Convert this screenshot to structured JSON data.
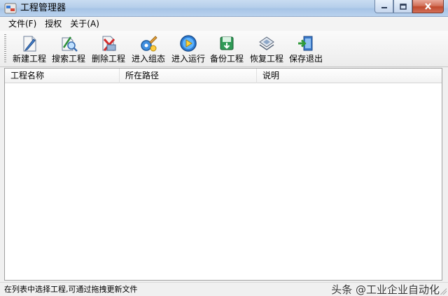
{
  "window": {
    "title": "工程管理器",
    "caption_buttons": [
      "minimize-button",
      "maximize-button",
      "close-button"
    ]
  },
  "menubar": {
    "items": [
      {
        "label": "文件(F)"
      },
      {
        "label": "授权"
      },
      {
        "label": "关于(A)"
      }
    ]
  },
  "toolbar": {
    "buttons": [
      {
        "label": "新建工程",
        "icon": "new-project-icon"
      },
      {
        "label": "搜索工程",
        "icon": "search-project-icon"
      },
      {
        "label": "删除工程",
        "icon": "delete-project-icon"
      },
      {
        "label": "进入组态",
        "icon": "configure-icon"
      },
      {
        "label": "进入运行",
        "icon": "run-icon"
      },
      {
        "label": "备份工程",
        "icon": "backup-icon"
      },
      {
        "label": "恢复工程",
        "icon": "restore-icon"
      },
      {
        "label": "保存退出",
        "icon": "save-exit-icon"
      }
    ]
  },
  "list": {
    "columns": [
      {
        "label": "工程名称"
      },
      {
        "label": "所在路径"
      },
      {
        "label": "说明"
      }
    ],
    "rows": []
  },
  "statusbar": {
    "text": "在列表中选择工程,可通过拖拽更新文件",
    "watermark": "头条 @工业企业自动化"
  },
  "colors": {
    "titlebar": "#b6cfeb",
    "close_button": "#c04a2d",
    "list_background": "#ffffff"
  }
}
